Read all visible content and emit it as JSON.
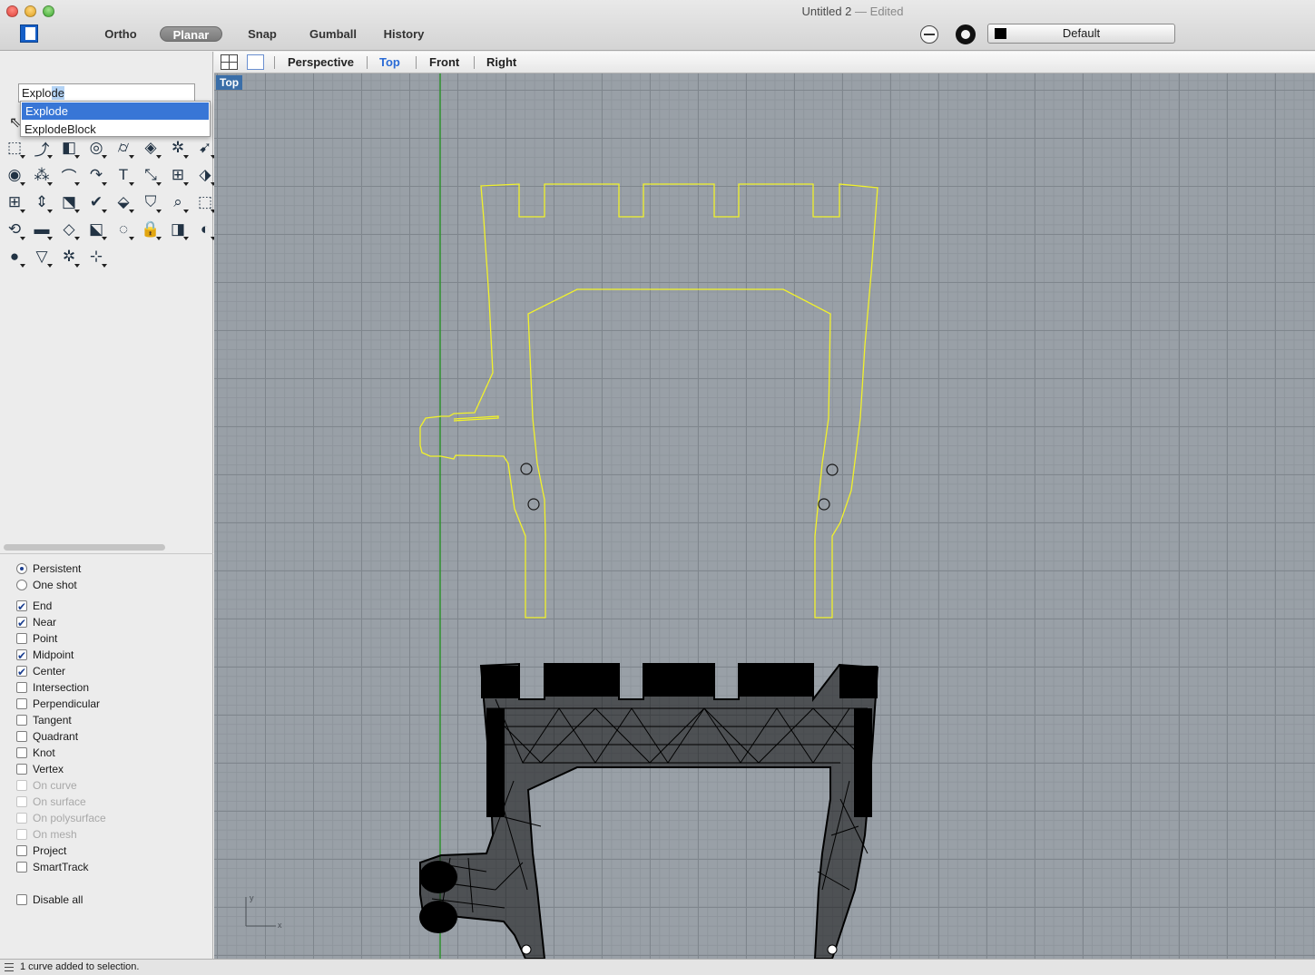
{
  "window": {
    "title": "Untitled 2",
    "edited": "— Edited"
  },
  "toolbar": {
    "buttons": [
      {
        "label": "Ortho",
        "active": false
      },
      {
        "label": "Planar",
        "active": true
      },
      {
        "label": "Snap",
        "active": false
      },
      {
        "label": "Gumball",
        "active": false
      },
      {
        "label": "History",
        "active": false
      }
    ],
    "layer": "Default",
    "layer_color": "#000000"
  },
  "command": {
    "typed": "Explo",
    "completion": "de",
    "suggestions": [
      "Explode",
      "ExplodeBlock"
    ],
    "selected_index": 0
  },
  "tools": [
    "transform-icon",
    "curve-tools-icon",
    "solid-box-icon",
    "boolean-icon",
    "cylinder-icon",
    "surface-tools-icon",
    "gear-icon",
    "arrow-icon",
    "fillet-icon",
    "object-snap-icon",
    "arc-icon",
    "curve-blend-icon",
    "text-icon",
    "scale-icon",
    "array-icon",
    "dimension-icon",
    "grid-icon",
    "move-icon",
    "extrude-icon",
    "check-icon",
    "shade-icon",
    "paint-bucket-icon",
    "zoom-icon",
    "zoom-window-icon",
    "rotate-view-icon",
    "car-icon",
    "plane-icon",
    "layer-icon",
    "light-icon",
    "lock-icon",
    "render-icon",
    "color-wheel-icon",
    "sphere-icon",
    "cone-icon",
    "gear-small-icon",
    "cplane-icon"
  ],
  "osnap": {
    "modes": [
      {
        "label": "Persistent",
        "type": "radio",
        "checked": true
      },
      {
        "label": "One shot",
        "type": "radio",
        "checked": false
      }
    ],
    "snaps": [
      {
        "label": "End",
        "checked": true,
        "disabled": false
      },
      {
        "label": "Near",
        "checked": true,
        "disabled": false
      },
      {
        "label": "Point",
        "checked": false,
        "disabled": false
      },
      {
        "label": "Midpoint",
        "checked": true,
        "disabled": false
      },
      {
        "label": "Center",
        "checked": true,
        "disabled": false
      },
      {
        "label": "Intersection",
        "checked": false,
        "disabled": false
      },
      {
        "label": "Perpendicular",
        "checked": false,
        "disabled": false
      },
      {
        "label": "Tangent",
        "checked": false,
        "disabled": false
      },
      {
        "label": "Quadrant",
        "checked": false,
        "disabled": false
      },
      {
        "label": "Knot",
        "checked": false,
        "disabled": false
      },
      {
        "label": "Vertex",
        "checked": false,
        "disabled": false
      },
      {
        "label": "On curve",
        "checked": false,
        "disabled": true
      },
      {
        "label": "On surface",
        "checked": false,
        "disabled": true
      },
      {
        "label": "On polysurface",
        "checked": false,
        "disabled": true
      },
      {
        "label": "On mesh",
        "checked": false,
        "disabled": true
      },
      {
        "label": "Project",
        "checked": false,
        "disabled": false
      },
      {
        "label": "SmartTrack",
        "checked": false,
        "disabled": false
      }
    ],
    "disable_all": {
      "label": "Disable all",
      "checked": false
    }
  },
  "viewport_tabs": [
    {
      "label": "Perspective",
      "active": false
    },
    {
      "label": "Top",
      "active": true
    },
    {
      "label": "Front",
      "active": false
    },
    {
      "label": "Right",
      "active": false
    }
  ],
  "viewport": {
    "name": "Top",
    "axis_y": "y",
    "axis_x": "x",
    "curve_color": "#f2f22a",
    "axis_color": "#2f8f2f"
  },
  "status": "1 curve added to selection."
}
